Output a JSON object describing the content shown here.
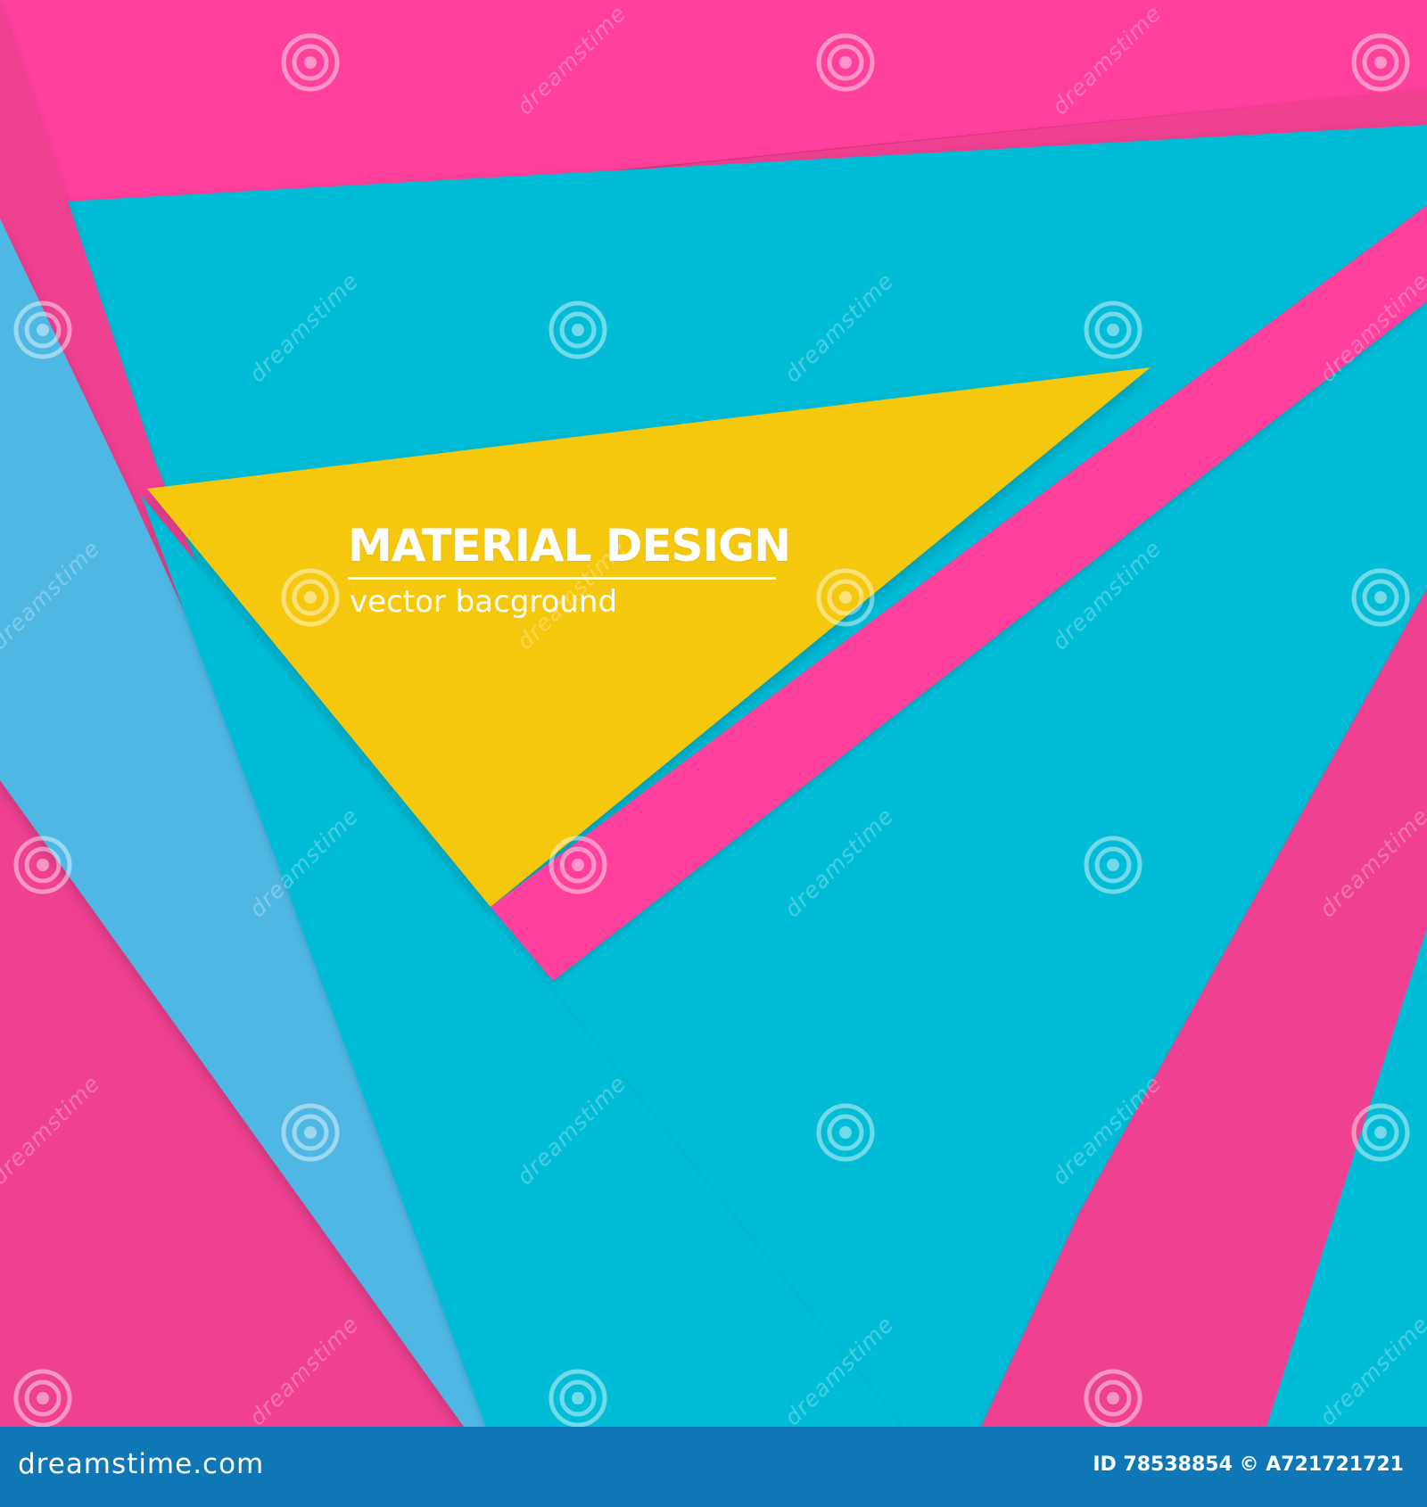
{
  "title": {
    "main": "MATERIAL DESIGN",
    "subtitle": "vector bacground"
  },
  "footer": {
    "brand": "dreamstime.com",
    "image_id": "ID 78538854 © A721721721"
  },
  "watermark": {
    "text": "dreamstime",
    "icon": "spiral-logo-icon"
  },
  "colors": {
    "hot_pink": "#ff3f9d",
    "deep_pink": "#ef3f91",
    "cyan": "#00bcd7",
    "sky_blue": "#50b7e3",
    "yellow": "#f6c80c",
    "footer_blue": "#0f77b5"
  }
}
